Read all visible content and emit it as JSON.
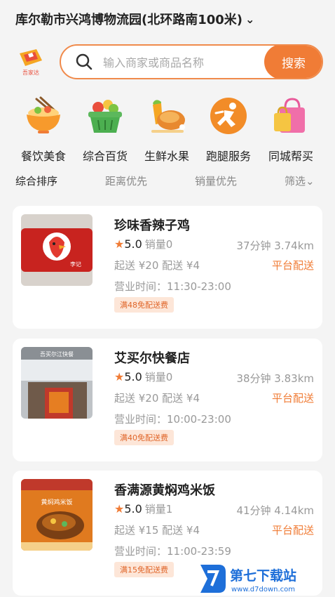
{
  "location": {
    "address": "库尔勒市兴鸿博物流园(北环路南100米)",
    "chevron": "⌄"
  },
  "search": {
    "placeholder": "输入商家或商品名称",
    "button": "搜索",
    "logo_text": "吾家达"
  },
  "categories": [
    {
      "label": "餐饮美食",
      "icon": "food-bowl-icon"
    },
    {
      "label": "综合百货",
      "icon": "basket-icon"
    },
    {
      "label": "生鲜水果",
      "icon": "fresh-chicken-icon"
    },
    {
      "label": "跑腿服务",
      "icon": "runner-icon"
    },
    {
      "label": "同城帮买",
      "icon": "shopping-bag-icon"
    }
  ],
  "sort": {
    "items": [
      "综合排序",
      "距离优先",
      "销量优先",
      "筛选⌄"
    ],
    "active": 0
  },
  "stores": [
    {
      "name": "珍味香辣子鸡",
      "star": "★",
      "rating": "5.0",
      "sales": "销量0",
      "eta": "37分钟 3.74km",
      "fees": "起送 ¥20 配送 ¥4",
      "delivery": "平台配送",
      "hours": "营业时间：11:30-23:00",
      "promo": "满48免配送费",
      "thumb_text": "李记"
    },
    {
      "name": "艾买尔快餐店",
      "star": "★",
      "rating": "5.0",
      "sales": "销量0",
      "eta": "38分钟 3.83km",
      "fees": "起送 ¥20 配送 ¥4",
      "delivery": "平台配送",
      "hours": "营业时间：10:00-23:00",
      "promo": "满40免配送费",
      "thumb_text": "吾买尔江快餐"
    },
    {
      "name": "香满源黄焖鸡米饭",
      "star": "★",
      "rating": "5.0",
      "sales": "销量1",
      "eta": "41分钟 4.14km",
      "fees": "起送 ¥15 配送 ¥4",
      "delivery": "平台配送",
      "hours": "营业时间：11:00-23:59",
      "promo": "满15免配送费",
      "thumb_text": "黄焖鸡米饭"
    }
  ],
  "watermark": {
    "title": "第七下载站",
    "url": "www.d7down.com"
  },
  "colors": {
    "accent": "#f07c36",
    "background": "#f4f4f4"
  }
}
